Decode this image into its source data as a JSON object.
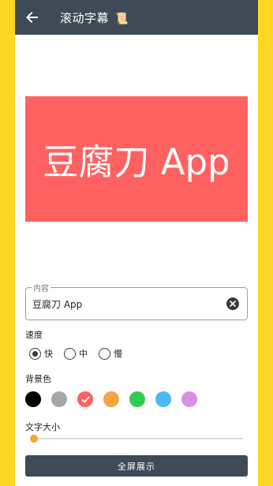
{
  "appbar": {
    "title": "滚动字幕",
    "title_icon": "scroll-icon",
    "back_icon": "arrow-back-icon",
    "background": "#3e4b57"
  },
  "preview": {
    "text": "豆腐刀 App",
    "background": "#ff6161",
    "text_color": "#ffffff"
  },
  "content_field": {
    "label": "内容",
    "value": "豆腐刀 App",
    "clear_icon": "clear-icon"
  },
  "speed": {
    "label": "速度",
    "options": [
      "快",
      "中",
      "慢"
    ],
    "selected": "快"
  },
  "background_color": {
    "label": "背景色",
    "swatches": [
      "#000000",
      "#a6a6a6",
      "#ff6161",
      "#f6a543",
      "#2fcc50",
      "#4fb8f2",
      "#d593e6"
    ],
    "selected_index": 2
  },
  "text_size": {
    "label": "文字大小",
    "value_fraction": 0.02,
    "accent": "#f0a63a"
  },
  "fullscreen_button": {
    "label": "全屏展示"
  },
  "page_background": "#ffd622"
}
